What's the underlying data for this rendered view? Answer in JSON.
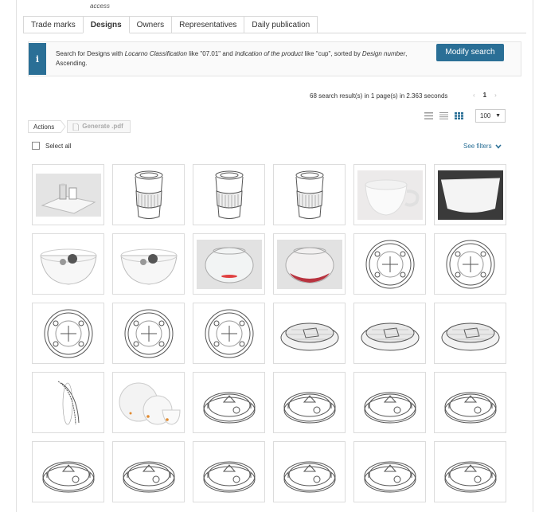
{
  "header": {
    "access_text": "access"
  },
  "tabs": [
    {
      "label": "Trade marks",
      "active": false
    },
    {
      "label": "Designs",
      "active": true
    },
    {
      "label": "Owners",
      "active": false
    },
    {
      "label": "Representatives",
      "active": false
    },
    {
      "label": "Daily publication",
      "active": false
    }
  ],
  "query": {
    "p1": "Search for Designs with ",
    "f1": "Locarno Classification",
    "p2": " like \"07.01\" and ",
    "f2": "Indication of the product",
    "p3": " like \"cup\", sorted by ",
    "f3": "Design number",
    "p4": ", Ascending."
  },
  "modify_button": "Modify search",
  "results_info": "68 search result(s) in 1 page(s) in 2.363 seconds",
  "pager": {
    "prev": "‹",
    "current": "1",
    "next": "›"
  },
  "page_size": "100",
  "actions": {
    "label": "Actions",
    "generate": "Generate .pdf"
  },
  "select_all": "Select all",
  "see_filters": "See filters",
  "colors": {
    "accent": "#2a6f96"
  },
  "thumbnails": [
    "tray-with-cups-photo",
    "cup-sleeve-drawing",
    "cup-sleeve-drawing",
    "cup-sleeve-drawing",
    "white-cup-photo",
    "white-bowl-photo",
    "glass-bowl-photo",
    "glass-bowl-photo",
    "glass-fishbowl-photo",
    "glass-fishbowl-red-photo",
    "lid-top-drawing",
    "lid-top-drawing",
    "lid-top-drawing",
    "lid-top-drawing",
    "lid-top-drawing",
    "lid-perspective-drawing",
    "lid-perspective-drawing",
    "lid-perspective-drawing",
    "lid-side-drawing",
    "plates-and-cup-photo",
    "lid-ring-drawing",
    "lid-ring-drawing",
    "lid-ring-drawing",
    "lid-ring-drawing",
    "lid-ring-drawing",
    "lid-ring-drawing",
    "lid-ring-drawing",
    "lid-ring-drawing",
    "lid-ring-drawing",
    "lid-ring-drawing"
  ]
}
